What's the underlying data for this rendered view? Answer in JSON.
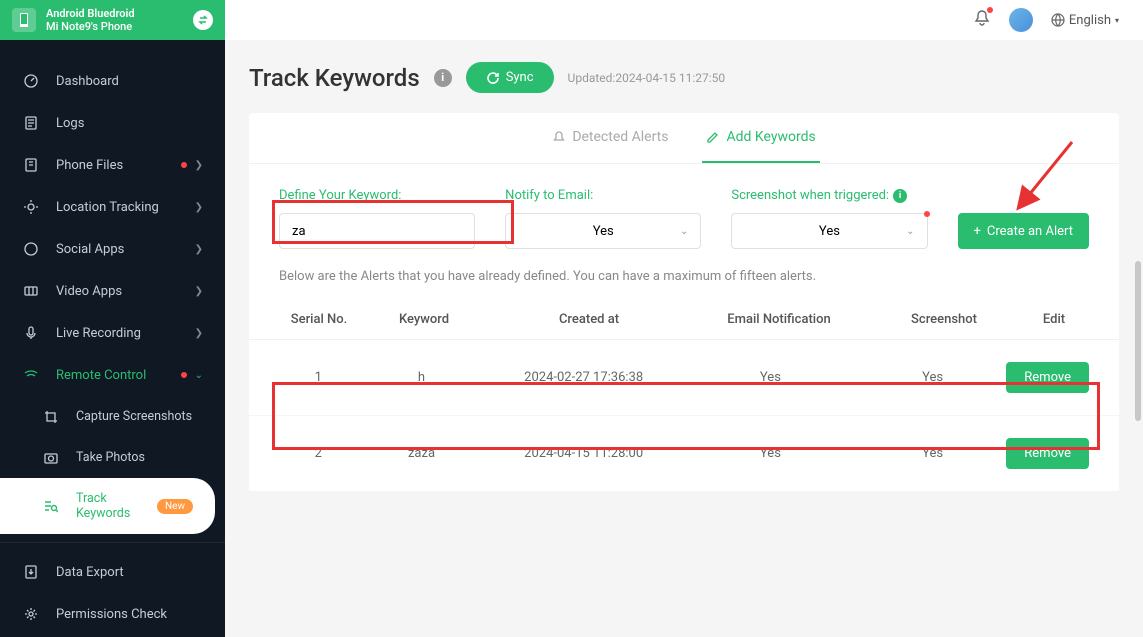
{
  "device": {
    "name": "Android Bluedroid",
    "phone": "Mi Note9's Phone"
  },
  "sidebar": {
    "items": [
      {
        "label": "Dashboard"
      },
      {
        "label": "Logs"
      },
      {
        "label": "Phone Files"
      },
      {
        "label": "Location Tracking"
      },
      {
        "label": "Social Apps"
      },
      {
        "label": "Video Apps"
      },
      {
        "label": "Live Recording"
      },
      {
        "label": "Remote Control"
      },
      {
        "label": "Capture Screenshots"
      },
      {
        "label": "Take Photos"
      },
      {
        "label": "Track Keywords",
        "badge": "New"
      },
      {
        "label": "Data Export"
      },
      {
        "label": "Permissions Check"
      }
    ]
  },
  "topbar": {
    "language": "English"
  },
  "page": {
    "title": "Track Keywords",
    "sync": "Sync",
    "updated": "Updated:2024-04-15 11:27:50"
  },
  "tabs": {
    "detected": "Detected Alerts",
    "add": "Add Keywords"
  },
  "form": {
    "define_label": "Define Your Keyword:",
    "define_value": "za",
    "notify_label": "Notify to Email:",
    "notify_value": "Yes",
    "screenshot_label": "Screenshot when triggered:",
    "screenshot_value": "Yes",
    "create_label": "Create an Alert"
  },
  "info_text": "Below are the Alerts that you have already defined. You can have a maximum of fifteen alerts.",
  "table": {
    "headers": {
      "serial": "Serial No.",
      "keyword": "Keyword",
      "created": "Created at",
      "email": "Email Notification",
      "screenshot": "Screenshot",
      "edit": "Edit"
    },
    "rows": [
      {
        "serial": "1",
        "keyword": "h",
        "created": "2024-02-27 17:36:38",
        "email": "Yes",
        "screenshot": "Yes",
        "remove": "Remove"
      },
      {
        "serial": "2",
        "keyword": "zaza",
        "created": "2024-04-15 11:28:00",
        "email": "Yes",
        "screenshot": "Yes",
        "remove": "Remove"
      }
    ]
  }
}
